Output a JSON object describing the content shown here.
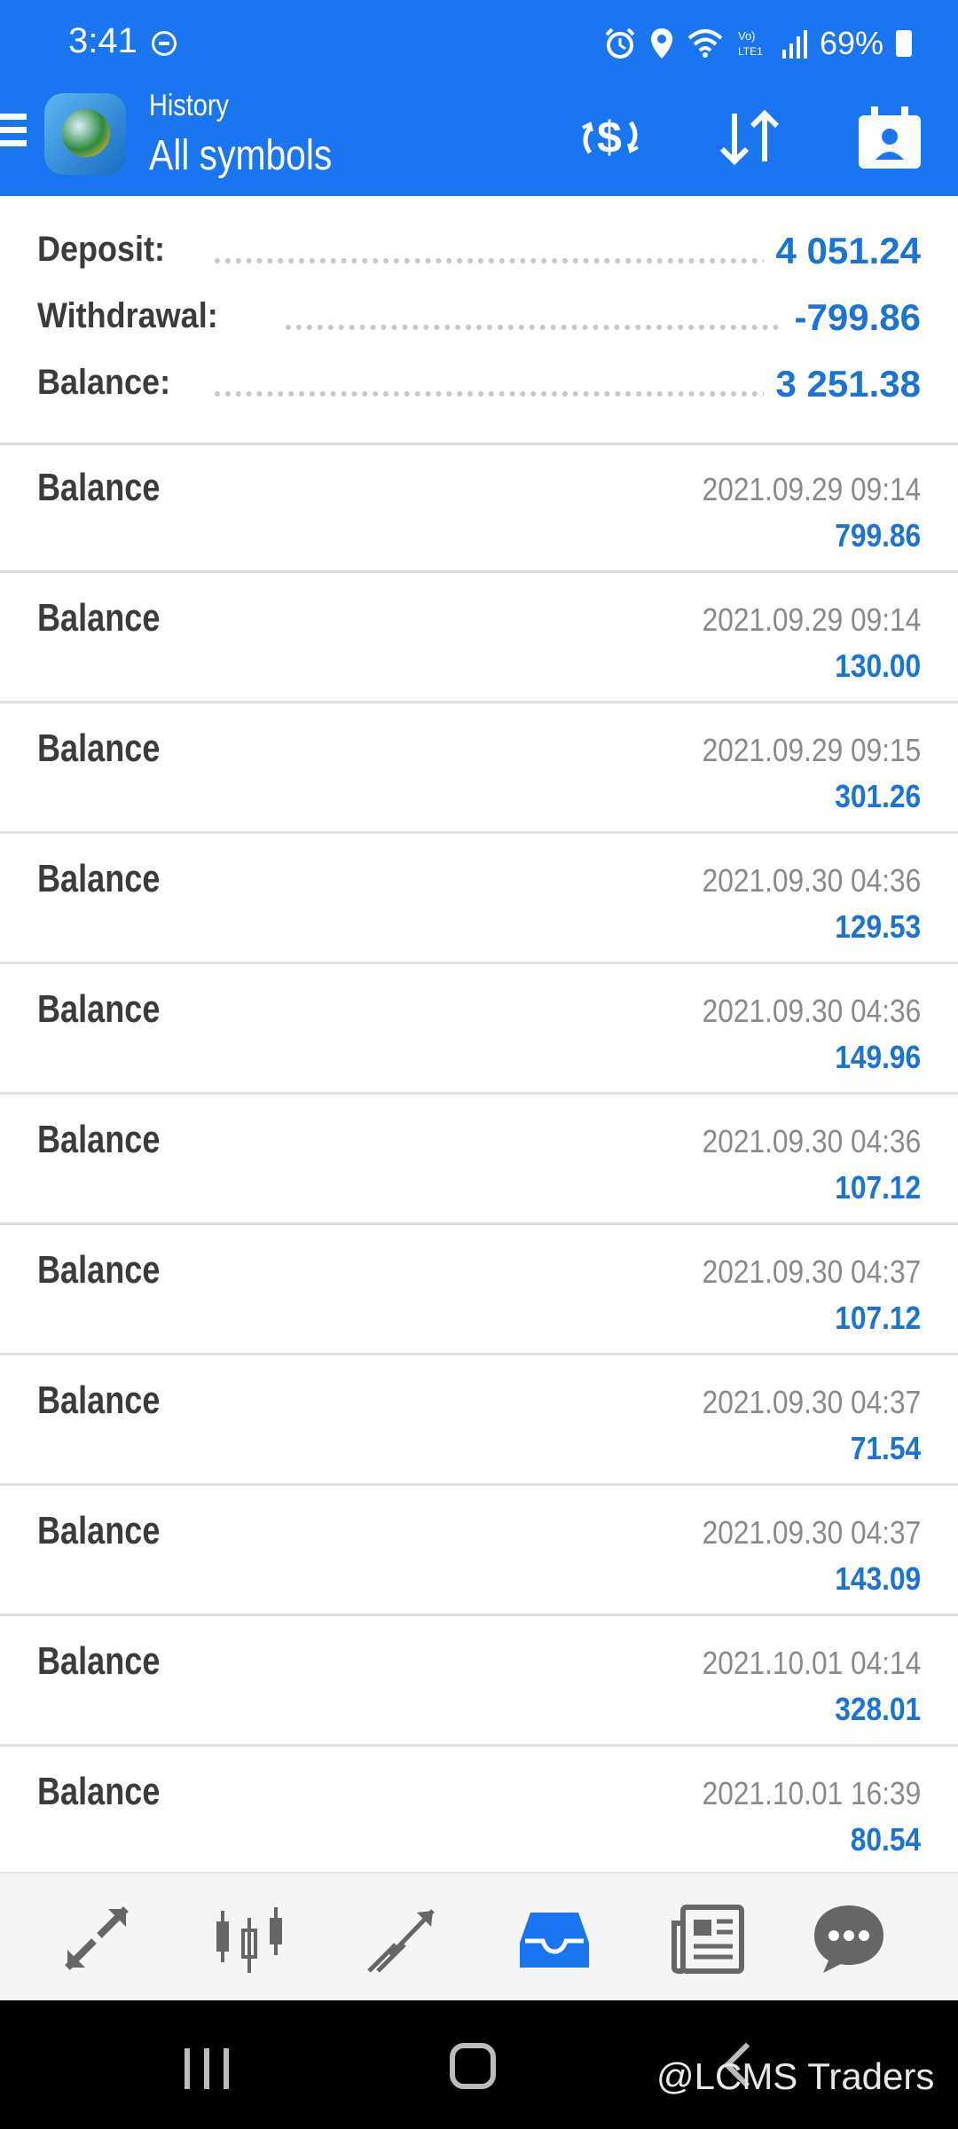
{
  "status_bar": {
    "time": "3:41",
    "battery": "69%",
    "icons": [
      "dnd-icon",
      "alarm-icon",
      "location-icon",
      "wifi-icon",
      "volte-icon",
      "signal-icon",
      "battery-icon"
    ]
  },
  "app_bar": {
    "title_small": "History",
    "title_big": "All symbols",
    "actions": [
      "currency-exchange-icon",
      "sort-icon",
      "calendar-contact-icon"
    ]
  },
  "summary": {
    "deposit_label": "Deposit:",
    "deposit_value": "4 051.24",
    "withdrawal_label": "Withdrawal:",
    "withdrawal_value": "-799.86",
    "balance_label": "Balance:",
    "balance_value": "3 251.38"
  },
  "entries": [
    {
      "type": "Balance",
      "date": "2021.09.29 09:14",
      "amount": "799.86"
    },
    {
      "type": "Balance",
      "date": "2021.09.29 09:14",
      "amount": "130.00"
    },
    {
      "type": "Balance",
      "date": "2021.09.29 09:15",
      "amount": "301.26"
    },
    {
      "type": "Balance",
      "date": "2021.09.30 04:36",
      "amount": "129.53"
    },
    {
      "type": "Balance",
      "date": "2021.09.30 04:36",
      "amount": "149.96"
    },
    {
      "type": "Balance",
      "date": "2021.09.30 04:36",
      "amount": "107.12"
    },
    {
      "type": "Balance",
      "date": "2021.09.30 04:37",
      "amount": "107.12"
    },
    {
      "type": "Balance",
      "date": "2021.09.30 04:37",
      "amount": "71.54"
    },
    {
      "type": "Balance",
      "date": "2021.09.30 04:37",
      "amount": "143.09"
    },
    {
      "type": "Balance",
      "date": "2021.10.01 04:14",
      "amount": "328.01"
    },
    {
      "type": "Balance",
      "date": "2021.10.01 16:39",
      "amount": "80.54"
    }
  ],
  "tabs": [
    "quotes-icon",
    "chart-icon",
    "trade-icon",
    "history-icon",
    "news-icon",
    "chat-icon"
  ],
  "active_tab": "history-icon",
  "watermark": "@LCMS Traders",
  "colors": {
    "accent": "#1976f0",
    "value": "#1a74d6",
    "label": "#3b3b3b",
    "date": "#8a8a8a"
  }
}
